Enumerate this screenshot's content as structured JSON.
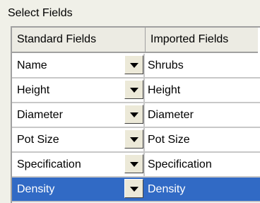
{
  "panel": {
    "title": "Select Fields"
  },
  "grid": {
    "columns": [
      "Standard Fields",
      "Imported Fields"
    ],
    "rows": [
      {
        "standard": "Name",
        "imported": "Shrubs",
        "selected": false
      },
      {
        "standard": "Height",
        "imported": "Height",
        "selected": false
      },
      {
        "standard": "Diameter",
        "imported": "Diameter",
        "selected": false
      },
      {
        "standard": "Pot Size",
        "imported": "Pot Size",
        "selected": false
      },
      {
        "standard": "Specification",
        "imported": "Specification",
        "selected": false
      },
      {
        "standard": "Density",
        "imported": "Density",
        "selected": true
      }
    ],
    "selection_color": "#316ac5"
  }
}
